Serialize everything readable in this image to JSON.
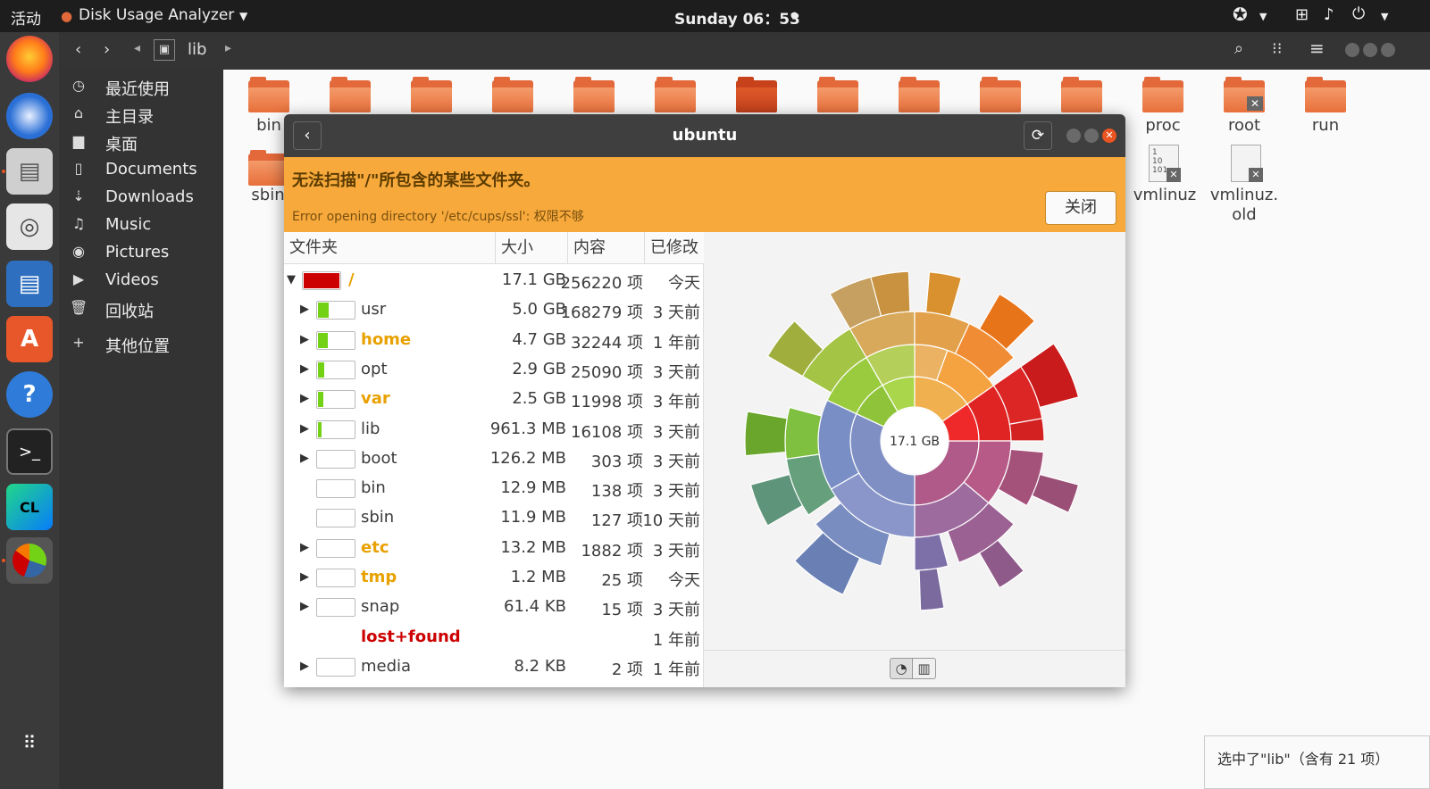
{
  "topbar": {
    "activities": "活动",
    "app_menu": "Disk Usage Analyzer",
    "clock": "Sunday 06：53"
  },
  "files": {
    "path_segment": "lib",
    "sidebar": [
      {
        "label": "最近使用",
        "icon": "clock-icon",
        "glyph": "◷"
      },
      {
        "label": "主目录",
        "icon": "home-icon",
        "glyph": "⌂"
      },
      {
        "label": "桌面",
        "icon": "folder-icon",
        "glyph": "▆"
      },
      {
        "label": "Documents",
        "icon": "document-icon",
        "glyph": "▯"
      },
      {
        "label": "Downloads",
        "icon": "download-icon",
        "glyph": "⇣"
      },
      {
        "label": "Music",
        "icon": "music-icon",
        "glyph": "♫"
      },
      {
        "label": "Pictures",
        "icon": "camera-icon",
        "glyph": "◉"
      },
      {
        "label": "Videos",
        "icon": "video-icon",
        "glyph": "▶"
      },
      {
        "label": "回收站",
        "icon": "trash-icon",
        "glyph": "🗑"
      },
      {
        "label": "其他位置",
        "icon": "plus-icon",
        "glyph": "+"
      }
    ],
    "visible_labels": {
      "bin": "bin",
      "sbin": "sbin",
      "proc": "proc",
      "root": "root",
      "run": "run",
      "vmlinuz": "vmlinuz",
      "vmlinuz_old_1": "vmlinuz.",
      "vmlinuz_old_2": "old"
    },
    "status": "选中了\"lib\"（含有 21 项）"
  },
  "dialog": {
    "title": "ubuntu",
    "warning_title": "无法扫描\"/\"所包含的某些文件夹。",
    "warning_detail": "Error opening directory '/etc/cups/ssl': 权限不够",
    "close_label": "关闭",
    "columns": {
      "folder": "文件夹",
      "size": "大小",
      "contents": "内容",
      "modified": "已修改"
    },
    "rows": [
      {
        "name": "/",
        "size": "17.1 GB",
        "items": "256220 项",
        "modified": "今天",
        "usage": 1.0,
        "color": "#cc0000",
        "bold": true,
        "name_color": "#e8a100",
        "expander": "▼"
      },
      {
        "name": "usr",
        "size": "5.0 GB",
        "items": "168279 项",
        "modified": "3 天前",
        "usage": 0.29,
        "color": "#73d216",
        "bold": false,
        "name_color": "#3c3c3c",
        "expander": "▶"
      },
      {
        "name": "home",
        "size": "4.7 GB",
        "items": "32244 项",
        "modified": "1 年前",
        "usage": 0.27,
        "color": "#73d216",
        "bold": true,
        "name_color": "#e8a100",
        "expander": "▶"
      },
      {
        "name": "opt",
        "size": "2.9 GB",
        "items": "25090 项",
        "modified": "3 天前",
        "usage": 0.17,
        "color": "#73d216",
        "bold": false,
        "name_color": "#3c3c3c",
        "expander": "▶"
      },
      {
        "name": "var",
        "size": "2.5 GB",
        "items": "11998 项",
        "modified": "3 年前",
        "usage": 0.15,
        "color": "#73d216",
        "bold": true,
        "name_color": "#e8a100",
        "expander": "▶"
      },
      {
        "name": "lib",
        "size": "961.3 MB",
        "items": "16108 项",
        "modified": "3 天前",
        "usage": 0.05,
        "color": "#73d216",
        "bold": false,
        "name_color": "#3c3c3c",
        "expander": "▶"
      },
      {
        "name": "boot",
        "size": "126.2 MB",
        "items": "303 项",
        "modified": "3 天前",
        "usage": 0.0,
        "color": "#73d216",
        "bold": false,
        "name_color": "#3c3c3c",
        "expander": "▶"
      },
      {
        "name": "bin",
        "size": "12.9 MB",
        "items": "138 项",
        "modified": "3 天前",
        "usage": 0.0,
        "color": "#73d216",
        "bold": false,
        "name_color": "#3c3c3c",
        "expander": ""
      },
      {
        "name": "sbin",
        "size": "11.9 MB",
        "items": "127 项",
        "modified": "10 天前",
        "usage": 0.0,
        "color": "#73d216",
        "bold": false,
        "name_color": "#3c3c3c",
        "expander": ""
      },
      {
        "name": "etc",
        "size": "13.2 MB",
        "items": "1882 项",
        "modified": "3 天前",
        "usage": 0.0,
        "color": "#73d216",
        "bold": true,
        "name_color": "#e8a100",
        "expander": "▶"
      },
      {
        "name": "tmp",
        "size": "1.2 MB",
        "items": "25 项",
        "modified": "今天",
        "usage": 0.0,
        "color": "#73d216",
        "bold": true,
        "name_color": "#e8a100",
        "expander": "▶"
      },
      {
        "name": "snap",
        "size": "61.4 KB",
        "items": "15 项",
        "modified": "3 天前",
        "usage": 0.0,
        "color": "#73d216",
        "bold": false,
        "name_color": "#3c3c3c",
        "expander": "▶"
      },
      {
        "name": "lost+found",
        "size": "",
        "items": "",
        "modified": "1 年前",
        "usage": null,
        "color": "",
        "bold": true,
        "name_color": "#cc0000",
        "expander": ""
      },
      {
        "name": "media",
        "size": "8.2 KB",
        "items": "2 项",
        "modified": "1 年前",
        "usage": 0.0,
        "color": "#73d216",
        "bold": false,
        "name_color": "#3c3c3c",
        "expander": "▶"
      }
    ],
    "chart_center_label": "17.1 GB"
  },
  "colors": {
    "accent_orange": "#f7a93b",
    "folder_orange": "#e4693a",
    "dark_panel": "#333333",
    "red": "#cc0000",
    "green": "#73d216"
  }
}
